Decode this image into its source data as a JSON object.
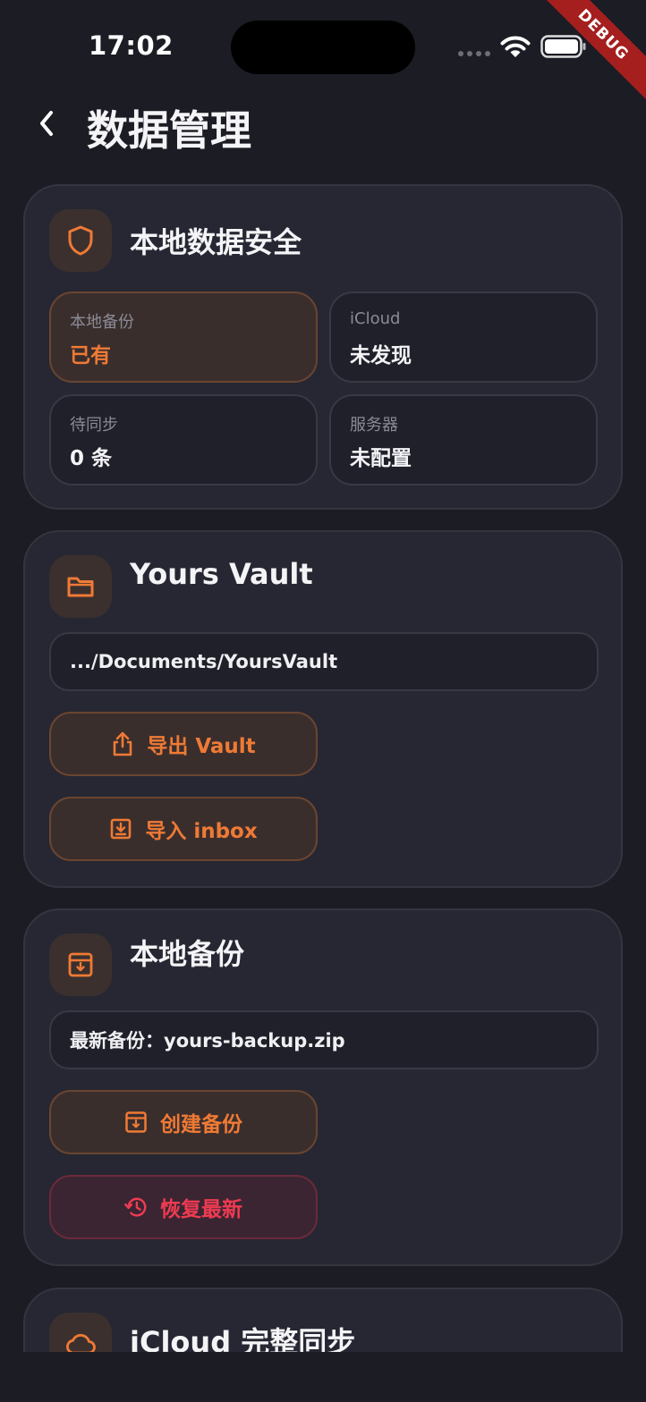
{
  "status": {
    "time": "17:02"
  },
  "debug_label": "DEBUG",
  "header": {
    "title": "数据管理"
  },
  "security": {
    "title": "本地数据安全",
    "stats": [
      {
        "label": "本地备份",
        "value": "已有"
      },
      {
        "label": "iCloud",
        "value": "未发现"
      },
      {
        "label": "待同步",
        "value": "0 条"
      },
      {
        "label": "服务器",
        "value": "未配置"
      }
    ]
  },
  "vault": {
    "title": "Yours Vault",
    "path": ".../Documents/YoursVault",
    "export_label": "导出 Vault",
    "import_label": "导入 inbox"
  },
  "backup": {
    "title": "本地备份",
    "latest": "最新备份：yours-backup.zip",
    "create_label": "创建备份",
    "restore_label": "恢复最新"
  },
  "icloud": {
    "title": "iCloud 完整同步"
  },
  "colors": {
    "accent": "#ef7a35",
    "danger": "#ee3b52",
    "background": "#1b1c24",
    "card": "#262732"
  }
}
